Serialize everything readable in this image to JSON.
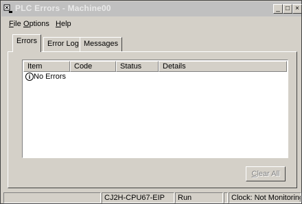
{
  "window": {
    "title": "PLC Errors - Machine00",
    "min_glyph": "_",
    "max_glyph": "□",
    "close_glyph": "×"
  },
  "menu": {
    "items": [
      {
        "label": "File",
        "mnemonic": "F",
        "rest": "ile"
      },
      {
        "label": "Options",
        "mnemonic": "O",
        "rest": "ptions"
      },
      {
        "label": "Help",
        "mnemonic": "H",
        "rest": "elp"
      }
    ]
  },
  "tabs": [
    {
      "label": "Errors",
      "active": true
    },
    {
      "label": "Error Log",
      "active": false
    },
    {
      "label": "Messages",
      "active": false
    }
  ],
  "list": {
    "columns": [
      "Item",
      "Code",
      "Status",
      "Details"
    ],
    "rows": [
      {
        "icon": "info-icon",
        "icon_glyph": "i",
        "text": "No Errors"
      }
    ]
  },
  "clear_button": {
    "label": "Clear All",
    "mnemonic": "C",
    "rest": "lear All",
    "enabled": false
  },
  "status_bar": {
    "cells": [
      "",
      "CJ2H-CPU67-EIP",
      "Run",
      "",
      "Clock: Not Monitoring"
    ]
  },
  "colors": {
    "face": "#d4d0c8",
    "title_bar": "#c0c0c0",
    "disabled_text": "#808080"
  }
}
